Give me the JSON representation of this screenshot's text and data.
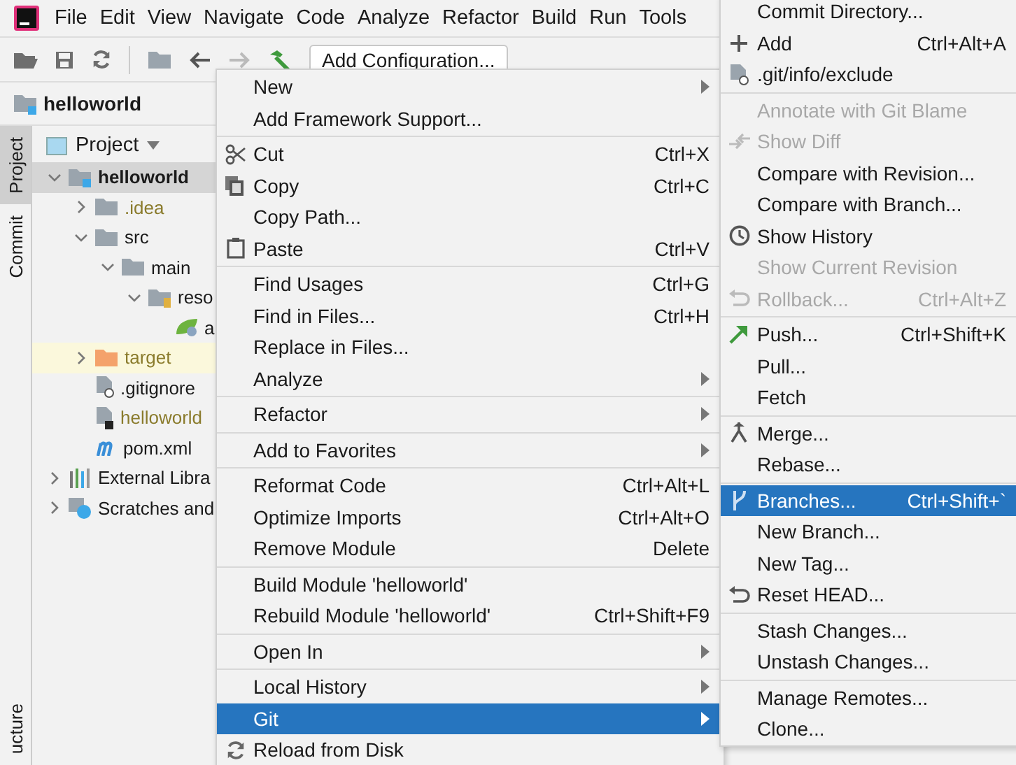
{
  "menu_bar": [
    "File",
    "Edit",
    "View",
    "Navigate",
    "Code",
    "Analyze",
    "Refactor",
    "Build",
    "Run",
    "Tools"
  ],
  "toolbar": {
    "run_config": "Add Configuration..."
  },
  "breadcrumb": "helloworld",
  "side_tabs": [
    {
      "label": "Project",
      "selected": true
    },
    {
      "label": "Commit",
      "selected": false
    }
  ],
  "side_tab_bottom": "ucture",
  "project_panel": {
    "title": "Project",
    "tree": [
      {
        "label": "helloworld",
        "kind": "module",
        "expanded": true,
        "selected": true,
        "ignored": false,
        "excluded": false,
        "children": [
          {
            "label": ".idea",
            "kind": "folder",
            "expanded": false,
            "selected": false,
            "ignored": true,
            "excluded": false
          },
          {
            "label": "src",
            "kind": "folder",
            "expanded": true,
            "selected": false,
            "ignored": false,
            "excluded": false,
            "children": [
              {
                "label": "main",
                "kind": "folder",
                "expanded": true,
                "selected": false,
                "ignored": false,
                "excluded": false,
                "children": [
                  {
                    "label": "reso",
                    "kind": "resources",
                    "expanded": true,
                    "selected": false,
                    "ignored": false,
                    "excluded": false,
                    "children": [
                      {
                        "label": "a",
                        "kind": "spring-file",
                        "selected": false,
                        "ignored": false,
                        "excluded": false
                      }
                    ]
                  }
                ]
              }
            ]
          },
          {
            "label": "target",
            "kind": "excluded-folder",
            "expanded": false,
            "selected": false,
            "ignored": true,
            "excluded": true
          },
          {
            "label": ".gitignore",
            "kind": "gitignore",
            "selected": false,
            "ignored": false,
            "excluded": false
          },
          {
            "label": "helloworld",
            "kind": "iml",
            "selected": false,
            "ignored": true,
            "excluded": false
          },
          {
            "label": "pom.xml",
            "kind": "maven",
            "selected": false,
            "ignored": false,
            "excluded": false
          }
        ]
      },
      {
        "label": "External Libra",
        "kind": "libraries",
        "expanded": false,
        "selected": false,
        "ignored": false,
        "excluded": false
      },
      {
        "label": "Scratches and",
        "kind": "scratches",
        "expanded": false,
        "selected": false,
        "ignored": false,
        "excluded": false
      }
    ]
  },
  "context_menu": [
    [
      {
        "label": "New",
        "submenu": true,
        "selected": false,
        "disabled": false
      },
      {
        "label": "Add Framework Support...",
        "submenu": false,
        "selected": false,
        "disabled": false
      }
    ],
    [
      {
        "label": "Cut",
        "shortcut": "Ctrl+X",
        "kind": "cut",
        "submenu": false,
        "selected": false,
        "disabled": false
      },
      {
        "label": "Copy",
        "shortcut": "Ctrl+C",
        "kind": "copy",
        "submenu": false,
        "selected": false,
        "disabled": false
      },
      {
        "label": "Copy Path...",
        "submenu": false,
        "selected": false,
        "disabled": false
      },
      {
        "label": "Paste",
        "shortcut": "Ctrl+V",
        "kind": "paste",
        "submenu": false,
        "selected": false,
        "disabled": false
      }
    ],
    [
      {
        "label": "Find Usages",
        "shortcut": "Ctrl+G",
        "submenu": false,
        "selected": false,
        "disabled": false
      },
      {
        "label": "Find in Files...",
        "shortcut": "Ctrl+H",
        "submenu": false,
        "selected": false,
        "disabled": false
      },
      {
        "label": "Replace in Files...",
        "submenu": false,
        "selected": false,
        "disabled": false
      },
      {
        "label": "Analyze",
        "submenu": true,
        "selected": false,
        "disabled": false
      }
    ],
    [
      {
        "label": "Refactor",
        "submenu": true,
        "selected": false,
        "disabled": false
      }
    ],
    [
      {
        "label": "Add to Favorites",
        "submenu": true,
        "selected": false,
        "disabled": false
      }
    ],
    [
      {
        "label": "Reformat Code",
        "shortcut": "Ctrl+Alt+L",
        "submenu": false,
        "selected": false,
        "disabled": false
      },
      {
        "label": "Optimize Imports",
        "shortcut": "Ctrl+Alt+O",
        "submenu": false,
        "selected": false,
        "disabled": false
      },
      {
        "label": "Remove Module",
        "shortcut": "Delete",
        "submenu": false,
        "selected": false,
        "disabled": false
      }
    ],
    [
      {
        "label": "Build Module 'helloworld'",
        "submenu": false,
        "selected": false,
        "disabled": false
      },
      {
        "label": "Rebuild Module 'helloworld'",
        "shortcut": "Ctrl+Shift+F9",
        "submenu": false,
        "selected": false,
        "disabled": false
      }
    ],
    [
      {
        "label": "Open In",
        "submenu": true,
        "selected": false,
        "disabled": false
      }
    ],
    [
      {
        "label": "Local History",
        "submenu": true,
        "selected": false,
        "disabled": false
      },
      {
        "label": "Git",
        "submenu": true,
        "selected": true,
        "disabled": false
      },
      {
        "label": "Reload from Disk",
        "kind": "sync",
        "submenu": false,
        "selected": false,
        "disabled": false
      }
    ]
  ],
  "git_menu": [
    [
      {
        "label": "Commit Directory...",
        "selected": false,
        "disabled": false
      },
      {
        "label": "Add",
        "shortcut": "Ctrl+Alt+A",
        "kind": "plus",
        "selected": false,
        "disabled": false
      },
      {
        "label": ".git/info/exclude",
        "kind": "file",
        "selected": false,
        "disabled": false
      }
    ],
    [
      {
        "label": "Annotate with Git Blame",
        "selected": false,
        "disabled": true
      },
      {
        "label": "Show Diff",
        "kind": "diff",
        "selected": false,
        "disabled": true
      },
      {
        "label": "Compare with Revision...",
        "selected": false,
        "disabled": false
      },
      {
        "label": "Compare with Branch...",
        "selected": false,
        "disabled": false
      },
      {
        "label": "Show History",
        "kind": "clock",
        "selected": false,
        "disabled": false
      },
      {
        "label": "Show Current Revision",
        "selected": false,
        "disabled": true
      },
      {
        "label": "Rollback...",
        "shortcut": "Ctrl+Alt+Z",
        "kind": "undo",
        "selected": false,
        "disabled": true
      }
    ],
    [
      {
        "label": "Push...",
        "shortcut": "Ctrl+Shift+K",
        "kind": "push",
        "selected": false,
        "disabled": false
      },
      {
        "label": "Pull...",
        "selected": false,
        "disabled": false
      },
      {
        "label": "Fetch",
        "selected": false,
        "disabled": false
      }
    ],
    [
      {
        "label": "Merge...",
        "kind": "merge",
        "selected": false,
        "disabled": false
      },
      {
        "label": "Rebase...",
        "selected": false,
        "disabled": false
      }
    ],
    [
      {
        "label": "Branches...",
        "shortcut": "Ctrl+Shift+`",
        "kind": "branch",
        "selected": true,
        "disabled": false
      },
      {
        "label": "New Branch...",
        "selected": false,
        "disabled": false
      },
      {
        "label": "New Tag...",
        "selected": false,
        "disabled": false
      },
      {
        "label": "Reset HEAD...",
        "kind": "undo",
        "selected": false,
        "disabled": false
      }
    ],
    [
      {
        "label": "Stash Changes...",
        "selected": false,
        "disabled": false
      },
      {
        "label": "Unstash Changes...",
        "selected": false,
        "disabled": false
      }
    ],
    [
      {
        "label": "Manage Remotes...",
        "selected": false,
        "disabled": false
      },
      {
        "label": "Clone...",
        "selected": false,
        "disabled": false
      }
    ]
  ]
}
